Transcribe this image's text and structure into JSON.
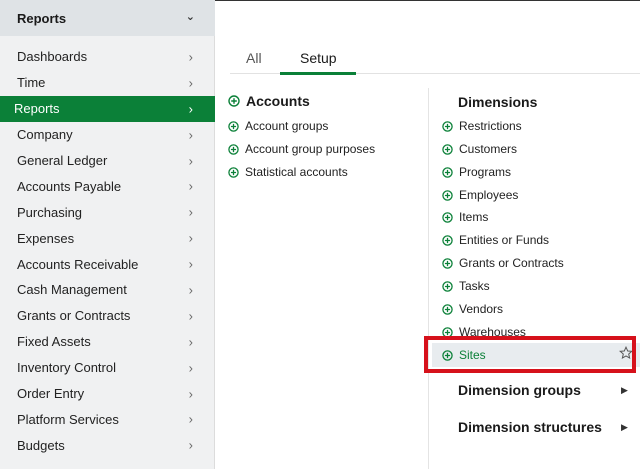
{
  "sidebar": {
    "header": "Reports",
    "items": [
      {
        "label": "Dashboards"
      },
      {
        "label": "Time"
      },
      {
        "label": "Reports",
        "active": true
      },
      {
        "label": "Company"
      },
      {
        "label": "General Ledger"
      },
      {
        "label": "Accounts Payable"
      },
      {
        "label": "Purchasing"
      },
      {
        "label": "Expenses"
      },
      {
        "label": "Accounts Receivable"
      },
      {
        "label": "Cash Management"
      },
      {
        "label": "Grants or Contracts"
      },
      {
        "label": "Fixed Assets"
      },
      {
        "label": "Inventory Control"
      },
      {
        "label": "Order Entry"
      },
      {
        "label": "Platform Services"
      },
      {
        "label": "Budgets"
      }
    ]
  },
  "tabs": {
    "all": "All",
    "setup": "Setup",
    "active": "Setup"
  },
  "accounts": {
    "heading": "Accounts",
    "links": [
      "Account groups",
      "Account group purposes",
      "Statistical accounts"
    ]
  },
  "dimensions": {
    "heading": "Dimensions",
    "links": [
      "Restrictions",
      "Customers",
      "Programs",
      "Employees",
      "Items",
      "Entities or Funds",
      "Grants or Contracts",
      "Tasks",
      "Vendors",
      "Warehouses",
      "Sites"
    ],
    "highlighted": "Sites"
  },
  "groups": {
    "dimension_groups": "Dimension groups",
    "dimension_structures": "Dimension structures"
  },
  "colors": {
    "accent": "#0b8038",
    "highlight": "#d6111b"
  }
}
